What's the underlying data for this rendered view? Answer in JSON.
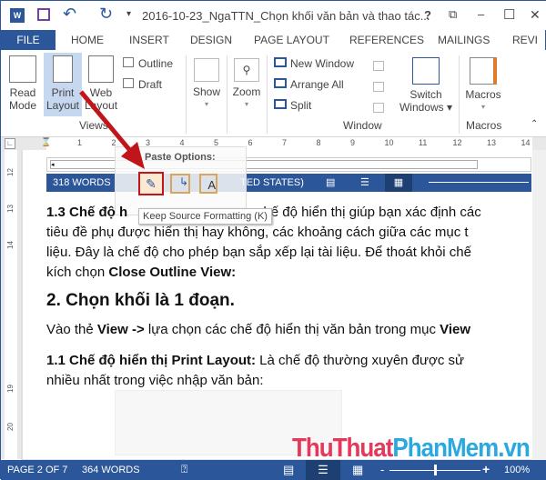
{
  "title_bar": {
    "title": "2016-10-23_NgaTTN_Chọn khối văn bản và thao tác...",
    "help": "?",
    "restore": "⧉",
    "minimize": "–",
    "maximize": "☐",
    "close": "✕"
  },
  "tabs": [
    "FILE",
    "HOME",
    "INSERT",
    "DESIGN",
    "PAGE LAYOUT",
    "REFERENCES",
    "MAILINGS",
    "REVI"
  ],
  "ribbon": {
    "views": {
      "label": "Views",
      "read_mode": [
        "Read",
        "Mode"
      ],
      "print_layout": [
        "Print",
        "Layout"
      ],
      "web_layout": [
        "Web",
        "Layout"
      ],
      "outline": "Outline",
      "draft": "Draft"
    },
    "show": "Show",
    "zoom": "Zoom",
    "window": {
      "label": "Window",
      "new_window": "New Window",
      "arrange_all": "Arrange All",
      "split": "Split",
      "switch_windows": [
        "Switch",
        "Windows ▾"
      ]
    },
    "macros": {
      "label": "Macros",
      "button": "Macros"
    }
  },
  "ruler_numbers": [
    "1",
    "2",
    "3",
    "4",
    "5",
    "6",
    "7",
    "8",
    "9",
    "10",
    "11",
    "12",
    "13",
    "14"
  ],
  "vruler_numbers": [
    "12",
    "13",
    "14",
    "19",
    "20"
  ],
  "embedded": {
    "words": "318 WORDS",
    "language": "TED STATES)"
  },
  "paste_options": {
    "title": "Paste Options:",
    "tooltip": "Keep Source Formatting (K)"
  },
  "document": {
    "p1": [
      {
        "b": "1.3 Chế độ h"
      },
      {
        "t": "                                  chế độ hiển thị giúp bạn xác định các"
      }
    ],
    "p1_l2": "tiêu đề phụ được hiển thị hay không, các khoảng cách giữa các mục t",
    "p1_l3": "liệu. Đây là chế độ cho phép bạn sắp xếp lại tài liệu. Để thoát khỏi chế",
    "p1_l4a": "kích chọn ",
    "p1_l4b": "Close Outline View:",
    "heading": "2. Chọn khối là 1 đoạn.",
    "p2a": "Vào thẻ ",
    "p2b": "View ->",
    "p2c": " lựa chọn các chế độ hiển thị văn bản trong mục ",
    "p2d": "View",
    "p3a": "1.1 Chế độ hiển thị Print Layout:",
    "p3b": " Là chế độ thường xuyên được sử",
    "p3_l2": "nhiều nhất trong việc nhập văn bản:"
  },
  "watermark": {
    "part1": "ThuThuat",
    "part2": "PhanMem.vn"
  },
  "status_bar": {
    "page": "PAGE 2 OF 7",
    "words": "364 WORDS",
    "zoom": "100%",
    "zoom_level": 100
  },
  "colors": {
    "accent": "#2b579a",
    "arrow": "#c0161b",
    "watermark_red": "#e5385a",
    "watermark_blue": "#2aa8e0"
  }
}
